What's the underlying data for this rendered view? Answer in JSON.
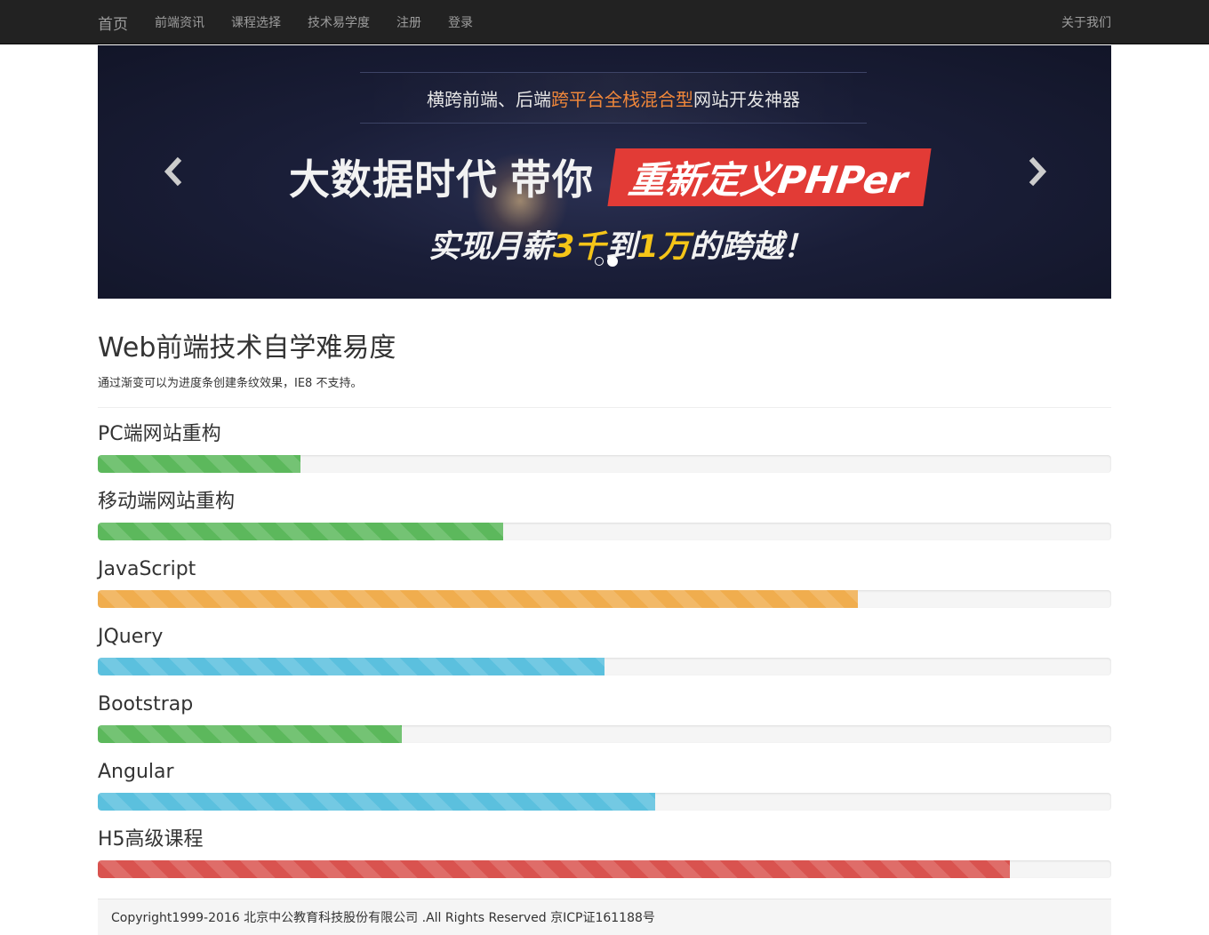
{
  "navbar": {
    "brand": "首页",
    "items": [
      "前端资讯",
      "课程选择",
      "技术易学度",
      "注册",
      "登录"
    ],
    "right_item": "关于我们"
  },
  "carousel": {
    "promo_prefix": "横跨前端、后端",
    "promo_highlight": "跨平台全栈混合型",
    "promo_suffix": "网站开发神器",
    "headline_part1": "大数据时代",
    "headline_part2": "带你",
    "headline_highlight": "重新定义PHPer",
    "subline_prefix": "实现月薪",
    "subline_num1": "3千",
    "subline_mid": "到",
    "subline_num2": "1万",
    "subline_suffix": "的跨越！",
    "prev_icon": "chevron-left-icon",
    "next_icon": "chevron-right-icon",
    "indicator_count": 2,
    "active_indicator": 1
  },
  "section": {
    "title": "Web前端技术自学难易度",
    "description": "通过渐变可以为进度条创建条纹效果，IE8 不支持。"
  },
  "skills": [
    {
      "label": "PC端网站重构",
      "percent": 20,
      "style": "success"
    },
    {
      "label": "移动端网站重构",
      "percent": 40,
      "style": "success"
    },
    {
      "label": "JavaScript",
      "percent": 75,
      "style": "warning"
    },
    {
      "label": "JQuery",
      "percent": 50,
      "style": "info"
    },
    {
      "label": "Bootstrap",
      "percent": 30,
      "style": "success"
    },
    {
      "label": "Angular",
      "percent": 55,
      "style": "info"
    },
    {
      "label": "H5高级课程",
      "percent": 90,
      "style": "danger"
    }
  ],
  "colors": {
    "success": "#5cb85c",
    "warning": "#f0ad4e",
    "info": "#5bc0de",
    "danger": "#d9534f",
    "navbar_bg": "#222222"
  },
  "footer": {
    "text": "Copyright1999-2016 北京中公教育科技股份有限公司 .All Rights Reserved 京ICP证161188号"
  }
}
